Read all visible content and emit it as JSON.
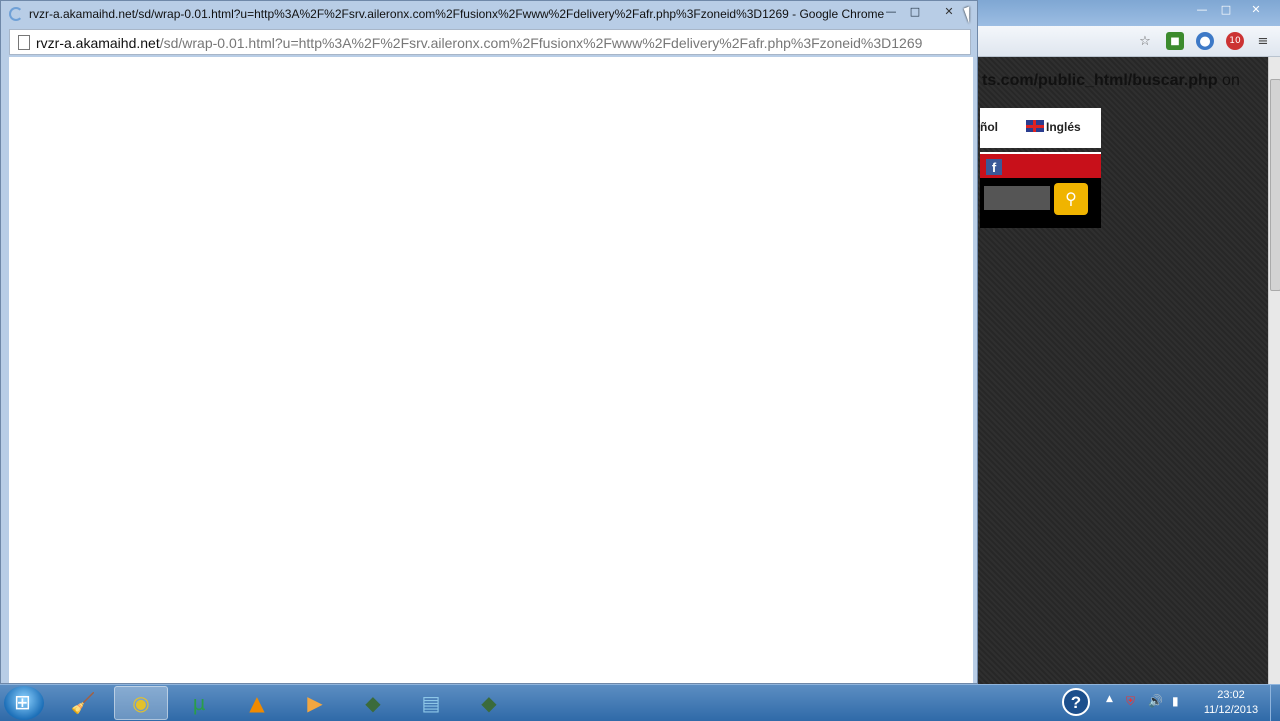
{
  "background_window": {
    "url_fragment": "ts.com/public_html/buscar.php",
    "url_suffix": "on",
    "lang_spanish": "ñol",
    "lang_english": "Inglés",
    "facebook_glyph": "f",
    "win_minimize": "—",
    "win_maximize": "□",
    "win_close": "✕",
    "star_glyph": "☆",
    "ext_badge": "10",
    "menu_glyph": "≡"
  },
  "popup_window": {
    "title": "rvzr-a.akamaihd.net/sd/wrap-0.01.html?u=http%3A%2F%2Fsrv.aileronx.com%2Ffusionx%2Fwww%2Fdelivery%2Fafr.php%3Fzoneid%3D1269 - Google Chrome",
    "url_host": "rvzr-a.akamaihd.net",
    "url_rest": "/sd/wrap-0.01.html?u=http%3A%2F%2Fsrv.aileronx.com%2Ffusionx%2Fwww%2Fdelivery%2Fafr.php%3Fzoneid%3D1269",
    "min_glyph": "—",
    "max_glyph": "□",
    "close_glyph": "✕"
  },
  "taskbar": {
    "items": [
      {
        "name": "cleaner-app",
        "glyph": "🧹",
        "color": "#d9552b"
      },
      {
        "name": "chrome",
        "glyph": "◉",
        "color": "#e3c12b"
      },
      {
        "name": "utorrent",
        "glyph": "µ",
        "color": "#2a9d4a"
      },
      {
        "name": "vlc",
        "glyph": "▲",
        "color": "#f08a00"
      },
      {
        "name": "media-player",
        "glyph": "▶",
        "color": "#f2a640"
      },
      {
        "name": "game-app",
        "glyph": "◆",
        "color": "#3b6b3b"
      },
      {
        "name": "notepad",
        "glyph": "▤",
        "color": "#8ec7e8"
      },
      {
        "name": "game-app-2",
        "glyph": "◆",
        "color": "#3b6b3b"
      }
    ],
    "help_glyph": "?",
    "tray_arrow": "▲",
    "tray_shield": "⛨",
    "tray_volume": "🔊",
    "tray_signal": "▮",
    "time": "23:02",
    "date": "11/12/2013"
  }
}
